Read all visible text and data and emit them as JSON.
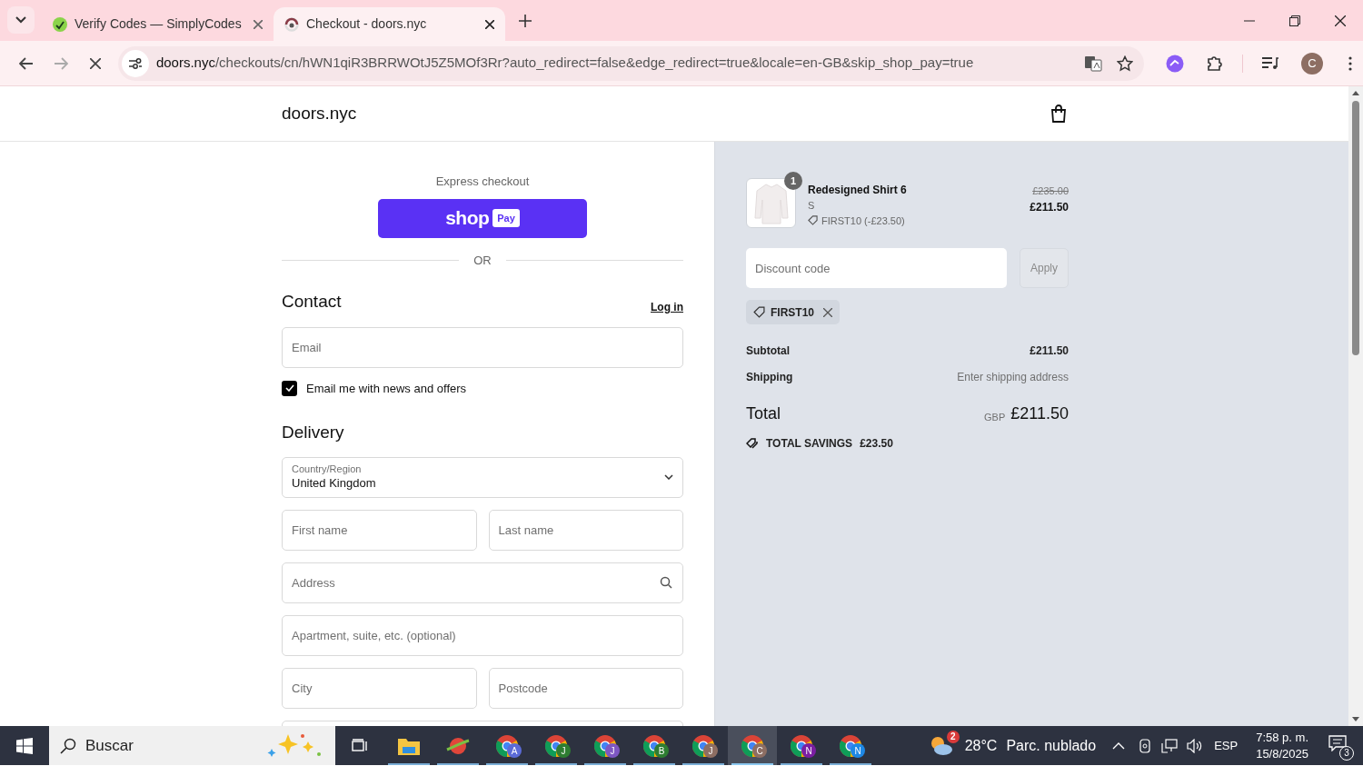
{
  "browser": {
    "tabs": [
      {
        "title": "Verify Codes — SimplyCodes",
        "selected": false
      },
      {
        "title": "Checkout - doors.nyc",
        "selected": true
      }
    ],
    "url_host": "doors.nyc",
    "url_path": "/checkouts/cn/hWN1qiR3BRRWOtJ5Z5MOf3Rr?auto_redirect=false&edge_redirect=true&locale=en-GB&skip_shop_pay=true",
    "profile_initial": "C"
  },
  "header": {
    "store_name": "doors.nyc"
  },
  "checkout": {
    "express_label": "Express checkout",
    "shop_pay": {
      "word": "shop",
      "badge": "Pay"
    },
    "or_label": "OR",
    "contact": {
      "heading": "Contact",
      "login": "Log in",
      "email_placeholder": "Email",
      "newsletter": {
        "label": "Email me with news and offers",
        "checked": true
      }
    },
    "delivery": {
      "heading": "Delivery",
      "rows": [
        [
          {
            "kind": "select",
            "label": "Country/Region",
            "value": "United Kingdom"
          }
        ],
        [
          {
            "kind": "text",
            "placeholder": "First name"
          },
          {
            "kind": "text",
            "placeholder": "Last name"
          }
        ],
        [
          {
            "kind": "search",
            "placeholder": "Address"
          }
        ],
        [
          {
            "kind": "text",
            "placeholder": "Apartment, suite, etc. (optional)"
          }
        ],
        [
          {
            "kind": "text",
            "placeholder": "City"
          },
          {
            "kind": "text",
            "placeholder": "Postcode"
          }
        ]
      ]
    }
  },
  "summary": {
    "item": {
      "quantity": "1",
      "name": "Redesigned Shirt 6",
      "variant": "S",
      "discount": "FIRST10 (-£23.50)",
      "original_price": "£235.00",
      "price": "£211.50"
    },
    "discount_placeholder": "Discount code",
    "apply": "Apply",
    "applied_code": "FIRST10",
    "lines": [
      {
        "label": "Subtotal",
        "value": "£211.50",
        "muted": false
      },
      {
        "label": "Shipping",
        "value": "Enter shipping address",
        "muted": true
      }
    ],
    "total_label": "Total",
    "currency": "GBP",
    "total": "£211.50",
    "savings_label": "TOTAL SAVINGS",
    "savings": "£23.50"
  },
  "taskbar": {
    "search": "Buscar",
    "apps": [
      {
        "kind": "explorer",
        "selected": false
      },
      {
        "kind": "planet",
        "selected": false
      },
      {
        "kind": "chrome",
        "letter": "A",
        "color": "#5b6bd6",
        "selected": false
      },
      {
        "kind": "chrome",
        "letter": "J",
        "color": "#2e7d32",
        "selected": false
      },
      {
        "kind": "chrome",
        "letter": "J",
        "color": "#7e57c2",
        "selected": false
      },
      {
        "kind": "chrome",
        "letter": "B",
        "color": "#2e7d32",
        "selected": false
      },
      {
        "kind": "chrome",
        "letter": "J",
        "color": "#8d6e63",
        "selected": false
      },
      {
        "kind": "chrome",
        "letter": "C",
        "color": "#8d6e63",
        "selected": true
      },
      {
        "kind": "chrome",
        "letter": "N",
        "color": "#7b1fa2",
        "selected": false
      },
      {
        "kind": "chrome",
        "letter": "N",
        "color": "#1e88e5",
        "selected": false
      }
    ],
    "weather_badge": "2",
    "temperature": "28°C",
    "weather": "Parc. nublado",
    "language": "ESP",
    "time": "7:58 p. m.",
    "date": "15/8/2025",
    "notifications": "3"
  }
}
